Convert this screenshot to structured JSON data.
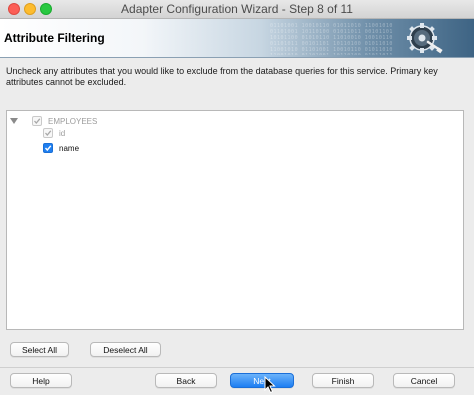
{
  "window": {
    "title": "Adapter Configuration Wizard - Step 8 of 11"
  },
  "banner": {
    "title": "Attribute Filtering",
    "icon": "gear-plug-icon"
  },
  "instructions": "Uncheck any attributes that you would like to exclude from the database queries for this service.  Primary key attributes cannot be excluded.",
  "tree": {
    "root": {
      "label": "EMPLOYEES",
      "checked": true,
      "enabled": false,
      "expanded": true
    },
    "children": [
      {
        "label": "id",
        "checked": true,
        "enabled": false
      },
      {
        "label": "name",
        "checked": true,
        "enabled": true
      }
    ]
  },
  "selection_buttons": {
    "select_all": "Select All",
    "deselect_all": "Deselect All"
  },
  "footer_buttons": {
    "help": "Help",
    "back": "Back",
    "next": "Next",
    "finish": "Finish",
    "cancel": "Cancel"
  },
  "colors": {
    "accent": "#1f7ff0",
    "close": "#fc5f57",
    "minimize": "#fdbc2e",
    "maximize": "#28c840"
  }
}
